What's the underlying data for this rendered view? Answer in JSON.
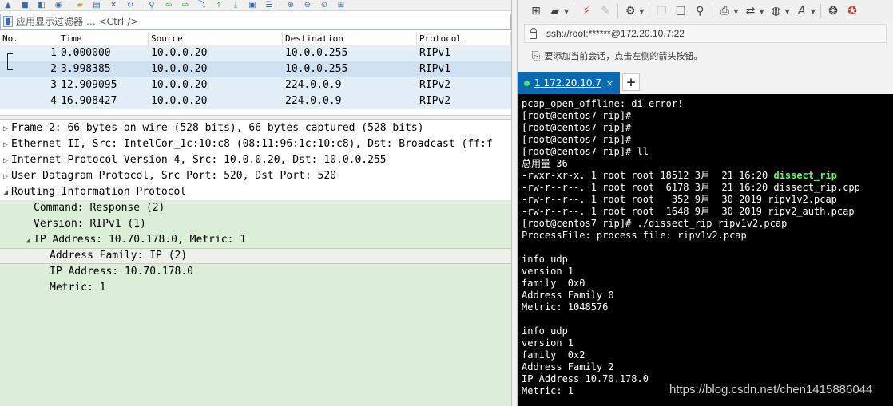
{
  "wireshark": {
    "toolbar_icons": [
      "stop-capture-icon",
      "stop-square-icon",
      "restart-icon",
      "options-gear-icon",
      "open-folder-icon",
      "save-file-icon",
      "close-file-icon",
      "reload-icon",
      "find-packet-icon",
      "go-back-icon",
      "go-forward-icon",
      "go-to-packet-icon",
      "go-first-icon",
      "go-last-icon",
      "autoscroll-icon",
      "colorize-icon",
      "zoom-in-icon",
      "zoom-out-icon",
      "zoom-reset-icon",
      "resize-columns-icon"
    ],
    "filter": {
      "placeholder": "应用显示过滤器 … <Ctrl-/>"
    },
    "packet_list": {
      "columns": [
        "No.",
        "Time",
        "Source",
        "Destination",
        "Protocol"
      ],
      "rows": [
        {
          "no": "1",
          "time": "0.000000",
          "source": "10.0.0.20",
          "destination": "10.0.0.255",
          "protocol": "RIPv1"
        },
        {
          "no": "2",
          "time": "3.998385",
          "source": "10.0.0.20",
          "destination": "10.0.0.255",
          "protocol": "RIPv1"
        },
        {
          "no": "3",
          "time": "12.909095",
          "source": "10.0.0.20",
          "destination": "224.0.0.9",
          "protocol": "RIPv2"
        },
        {
          "no": "4",
          "time": "16.908427",
          "source": "10.0.0.20",
          "destination": "224.0.0.9",
          "protocol": "RIPv2"
        }
      ],
      "selected_row": 2
    },
    "details": {
      "frame": "Frame 2: 66 bytes on wire (528 bits), 66 bytes captured (528 bits)",
      "ethernet": "Ethernet II, Src: IntelCor_1c:10:c8 (08:11:96:1c:10:c8), Dst: Broadcast (ff:f",
      "ip": "Internet Protocol Version 4, Src: 10.0.0.20, Dst: 10.0.0.255",
      "udp": "User Datagram Protocol, Src Port: 520, Dst Port: 520",
      "rip": "Routing Information Protocol",
      "command": "Command: Response (2)",
      "version": "Version: RIPv1 (1)",
      "ip_entry": "IP Address: 10.70.178.0, Metric: 1",
      "address_family": "Address Family: IP (2)",
      "ip_address": "IP Address: 10.70.178.0",
      "metric": "Metric: 1"
    }
  },
  "xshell": {
    "address": "ssh://root:******@172.20.10.7:22",
    "hint": "要添加当前会话，点击左侧的箭头按钮。",
    "tab": {
      "label": "1 172.20.10.7",
      "close": "×"
    },
    "add_tab": "+",
    "terminal_lines": [
      "pcap_open_offline: di error!",
      "[root@centos7 rip]#",
      "[root@centos7 rip]#",
      "[root@centos7 rip]#",
      "[root@centos7 rip]# ll",
      "总用量 36",
      "-rwxr-xr-x. 1 root root 18512 3月  21 16:20 ",
      "-rw-r--r--. 1 root root  6178 3月  21 16:20 dissect_rip.cpp",
      "-rw-r--r--. 1 root root   352 9月  30 2019 ripv1v2.pcap",
      "-rw-r--r--. 1 root root  1648 9月  30 2019 ripv2_auth.pcap",
      "[root@centos7 rip]# ./dissect_rip ripv1v2.pcap",
      "ProcessFile: process file: ripv1v2.pcap",
      "",
      "info udp",
      "version 1",
      "family  0x0",
      "Address Family 0",
      "Metric: 1048576",
      "",
      "info udp",
      "version 1",
      "family  0x2",
      "Address Family 2",
      "IP Address 10.70.178.0",
      "Metric: 1"
    ],
    "terminal_highlight": "dissect_rip",
    "watermark": "https://blog.csdn.net/chen1415886044"
  },
  "colors": {
    "selected_row": "#cfe0f1",
    "detail_green": "#daeed8",
    "tab_blue": "#0a6ab1",
    "terminal_bg": "#000000",
    "executable_green": "#55ff55"
  }
}
